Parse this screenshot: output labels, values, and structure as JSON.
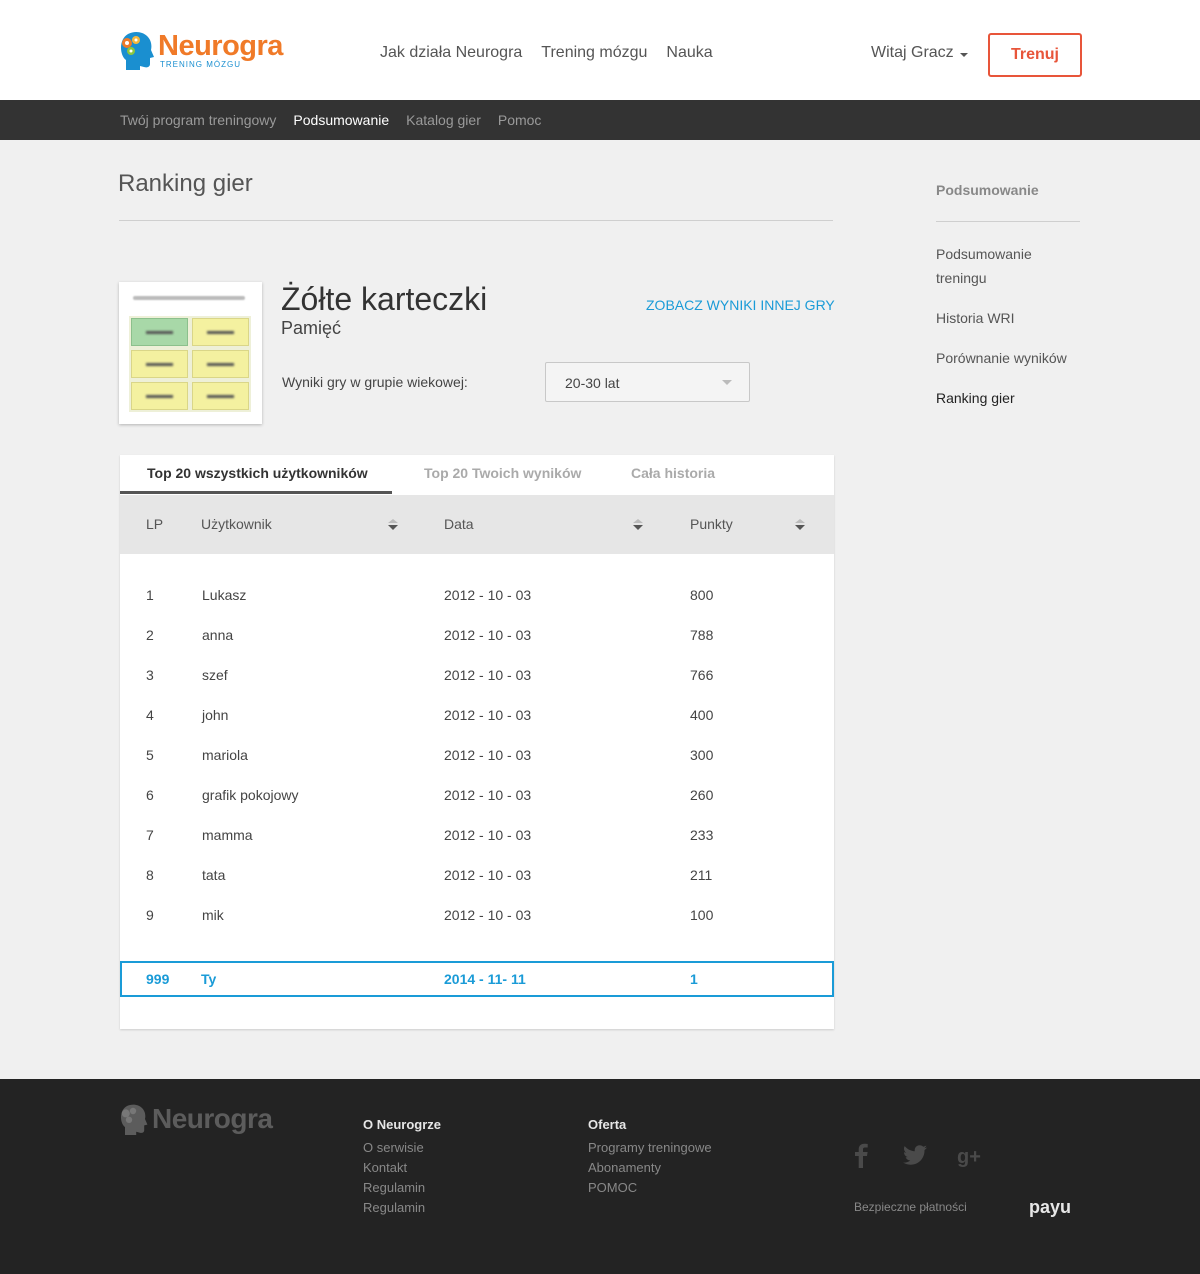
{
  "header": {
    "logo_text": "Neurogra",
    "logo_sub": "TRENING MÓZGU",
    "nav": [
      "Jak działa Neurogra",
      "Trening mózgu",
      "Nauka"
    ],
    "user_greeting": "Witaj Gracz",
    "cta_label": "Trenuj",
    "accent_color": "#e8553a",
    "brand_color": "#f07a28"
  },
  "subnav": {
    "items": [
      "Twój program treningowy",
      "Podsumowanie",
      "Katalog gier",
      "Pomoc"
    ],
    "active": "Podsumowanie"
  },
  "main": {
    "page_title": "Ranking gier",
    "game": {
      "name": "Żółte karteczki",
      "category": "Pamięć",
      "other_game_link": "ZOBACZ WYNIKI INNEJ GRY",
      "age_label": "Wyniki gry w grupie wiekowej:",
      "age_value": "20-30 lat"
    },
    "tabs": [
      "Top 20 wszystkich użytkowników",
      "Top 20 Twoich wyników",
      "Cała historia"
    ],
    "active_tab": "Top 20 wszystkich użytkowników",
    "table": {
      "columns": [
        "LP",
        "Użytkownik",
        "Data",
        "Punkty"
      ],
      "rows": [
        {
          "lp": "1",
          "user": "Lukasz",
          "date": "2012 - 10 - 03",
          "points": "800"
        },
        {
          "lp": "2",
          "user": "anna",
          "date": "2012 - 10 - 03",
          "points": "788"
        },
        {
          "lp": "3",
          "user": "szef",
          "date": "2012 - 10 - 03",
          "points": "766"
        },
        {
          "lp": "4",
          "user": "john",
          "date": "2012 - 10 - 03",
          "points": "400"
        },
        {
          "lp": "5",
          "user": "mariola",
          "date": "2012 - 10 - 03",
          "points": "300"
        },
        {
          "lp": "6",
          "user": "grafik pokojowy",
          "date": "2012 - 10 - 03",
          "points": "260"
        },
        {
          "lp": "7",
          "user": "mamma",
          "date": "2012 - 10 - 03",
          "points": "233"
        },
        {
          "lp": "8",
          "user": "tata",
          "date": "2012 - 10 - 03",
          "points": "211"
        },
        {
          "lp": "9",
          "user": "mik",
          "date": "2012 - 10 - 03",
          "points": "100"
        }
      ],
      "you": {
        "lp": "999",
        "user": "Ty",
        "date": "2014 - 11- 11",
        "points": "1"
      },
      "highlight_color": "#1a9bd7"
    }
  },
  "sidebar": {
    "heading": "Podsumowanie",
    "links": [
      "Podsumowanie treningu",
      "Historia WRI",
      "Porównanie wyników",
      "Ranking gier"
    ],
    "active": "Ranking gier"
  },
  "footer": {
    "logo_text": "Neurogra",
    "col1": {
      "title": "O Neurogrze",
      "links": [
        "O serwisie",
        "Kontakt",
        "Regulamin",
        "Regulamin"
      ]
    },
    "col2": {
      "title": "Oferta",
      "links": [
        "Programy treningowe",
        "Abonamenty",
        "POMOC"
      ]
    },
    "social": [
      "facebook-icon",
      "twitter-icon",
      "google-plus-icon"
    ],
    "secure_payments": "Bezpieczne płatności",
    "payu_label": "payu"
  }
}
